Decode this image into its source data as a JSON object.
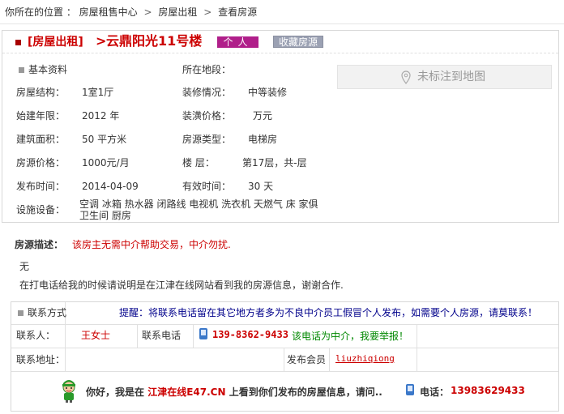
{
  "breadcrumb": {
    "prefix": "你所在的位置 ：",
    "items": [
      "房屋租售中心",
      "房屋出租",
      "查看房源"
    ],
    "separator": ">"
  },
  "listing": {
    "type_label": "[房屋出租]",
    "arrow": ">",
    "name": "云鼎阳光11号楼",
    "personal_label": "个人",
    "favorite_label": "收藏房源"
  },
  "details": {
    "basic_label": "基本资料",
    "location_label": "所在地段：",
    "location_value": "",
    "map_label": "未标注到地图",
    "structure_label": "房屋结构：",
    "structure_value": "1室1厅",
    "decoration_label": "装修情况：",
    "decoration_value": "中等装修",
    "year_label": "始建年限：",
    "year_value": "2012 年",
    "decor_price_label": "装潢价格：",
    "decor_price_value": "万元",
    "area_label": "建筑面积：",
    "area_value": "50 平方米",
    "house_type_label": "房源类型：",
    "house_type_value": "电梯房",
    "price_label": "房源价格：",
    "price_value": "1000元/月",
    "floor_label": "楼 层：",
    "floor_value": "第17层，共-层",
    "publish_label": "发布时间：",
    "publish_value": "2014-04-09",
    "valid_label": "有效时间：",
    "valid_value": "30 天",
    "facilities_label": "设施设备：",
    "facilities_value": "空调 冰箱 热水器 闭路线 电视机 洗衣机 天燃气 床 家俱 卫生间 厨房"
  },
  "description": {
    "title": "房源描述：",
    "note": "该房主无需中介帮助交易，中介勿扰.",
    "body": "无",
    "tip": "在打电话给我的时候请说明是在江津在线网站看到我的房源信息，谢谢合作."
  },
  "contact": {
    "section_label": "联系方式",
    "hint": "提醒：将联系电话留在其它地方者多为不良中介员工假冒个人发布，如需要个人房源，请莫联系！",
    "person_label": "联系人：",
    "person_value": "王女士",
    "phone_label": "联系电话",
    "phone_value": "139-8362-9433",
    "phone_warning": "该电话为中介，我要举报！",
    "address_label": "联系地址：",
    "address_value": "",
    "member_label": "发布会员",
    "member_value": "liuzhiqiong"
  },
  "footer": {
    "greeting_pre": "你好，我是在",
    "site": "江津在线E47.CN",
    "greeting_post": "上看到你们发布的房屋信息，请问..",
    "tel_label": "电话：",
    "tel_value": "13983629433"
  },
  "colors": {
    "accent_red": "#cc0000",
    "personal_badge": "#b01f8a",
    "favorite_button": "#9ba1b3",
    "hint_blue": "#00008b",
    "warning_green": "#008800"
  }
}
